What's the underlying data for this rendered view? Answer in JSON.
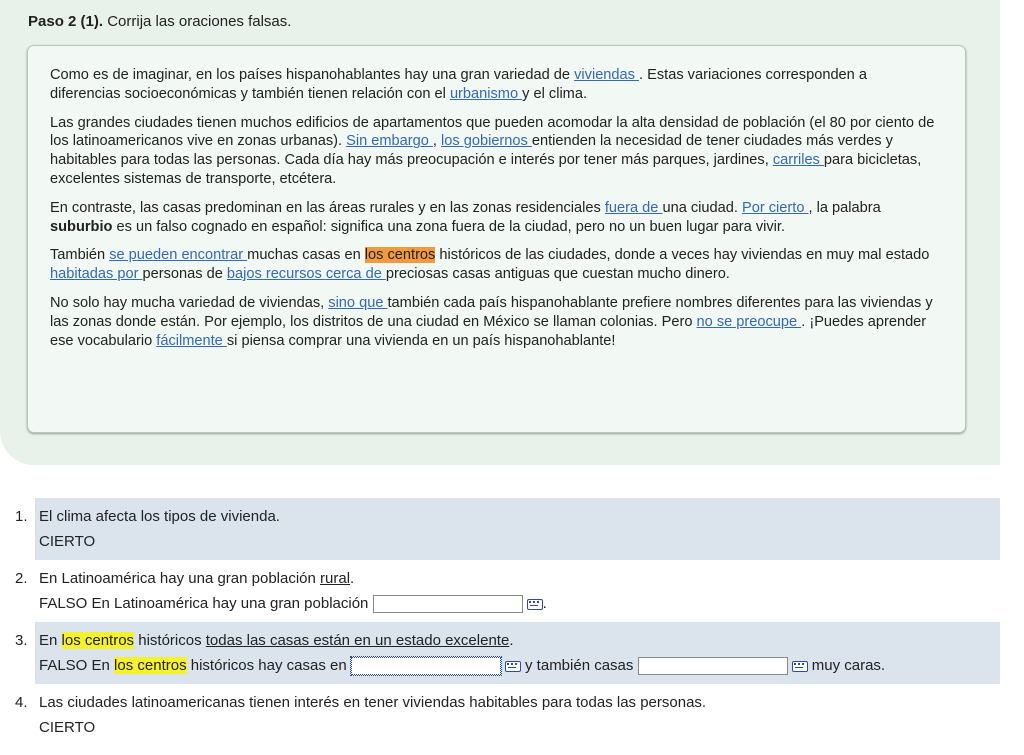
{
  "step": {
    "label": "Paso 2 (1).",
    "instruction": " Corrija las oraciones falsas."
  },
  "reading": {
    "p1": {
      "t1": "Como es de imaginar, en los países hispanohablantes hay una gran variedad de ",
      "g1": "viviendas ",
      "t2": ". Estas variaciones corresponden a diferencias socioeconómicas y también tienen relación con el ",
      "g2": "urbanismo ",
      "t3": " y el clima."
    },
    "p2": {
      "t1": "Las grandes ciudades tienen muchos edificios de apartamentos que pueden acomodar la alta densidad de población (el 80 por ciento de los latinoamericanos vive en zonas urbanas). ",
      "g1": "Sin embargo ",
      "t2": ", ",
      "g2": "los gobiernos ",
      "t3": " entienden la necesidad de tener ciudades más verdes y habitables para todas las personas. Cada día hay más preocupación e interés por tener más parques, jardines, ",
      "g3": "carriles ",
      "t4": " para bicicletas, excelentes sistemas de transporte, etcétera."
    },
    "p3": {
      "t1": "En contraste, las casas predominan en las áreas rurales y en las zonas residenciales ",
      "g1": "fuera de ",
      "t2": " una ciudad. ",
      "g2": "Por cierto ",
      "t3": ", la palabra ",
      "b1": "suburbio",
      "t4": " es un falso cognado en español: significa una zona fuera de la ciudad, pero no un buen lugar para vivir."
    },
    "p4": {
      "t1": "También ",
      "g1": "se pueden encontrar ",
      "t2": " muchas casas en ",
      "h1": "los centros",
      "t3": " históricos de las ciudades, donde a veces hay viviendas en muy mal estado ",
      "g2": "habitadas por ",
      "t4": " personas de ",
      "g3": "bajos recursos ",
      "t5": " ",
      "g4": "cerca de ",
      "t6": " preciosas casas antiguas que cuestan mucho dinero."
    },
    "p5": {
      "t1": "No solo hay mucha variedad de viviendas, ",
      "g1": "sino que ",
      "t2": " también cada país hispanohablante prefiere nombres diferentes para las viviendas y las zonas donde están. Por ejemplo, los distritos de una ciudad en México se llaman colonias. Pero ",
      "g2": "no se preocupe ",
      "t3": ". ¡Puedes aprender ese vocabulario ",
      "g3": "fácilmente ",
      "t4": " si piensa comprar una vivienda en un país hispanohablante!"
    }
  },
  "questions": [
    {
      "num": "1.",
      "statement": "El clima afecta los tipos de vivienda.",
      "answer": "CIERTO"
    },
    {
      "num": "2.",
      "s1": "En Latinoamérica hay una gran población ",
      "s_u": "rural",
      "s2": ".",
      "verdict": "FALSO",
      "a1": " En Latinoamérica hay una gran población ",
      "a2": "."
    },
    {
      "num": "3.",
      "s1": "En ",
      "s_hl": "los centros",
      "s2": " históricos ",
      "s_u": "todas las casas están en un estado excelente",
      "s3": ".",
      "verdict": "FALSO",
      "a1": " En ",
      "a_hl": "los centros",
      "a2": " históricos hay casas en ",
      "a3": " y también casas ",
      "a4": " muy caras."
    },
    {
      "num": "4.",
      "statement": "Las ciudades latinoamericanas tienen interés en tener viviendas habitables para todas las personas.",
      "answer": "CIERTO"
    }
  ],
  "colors": {
    "panel": "#e8f1ea",
    "box": "#f2f8f3",
    "gloss_link": "#3468b8",
    "orange_highlight": "#f39a3c",
    "yellow_highlight": "#f5f12a",
    "shaded_row": "#dbe3ec"
  }
}
